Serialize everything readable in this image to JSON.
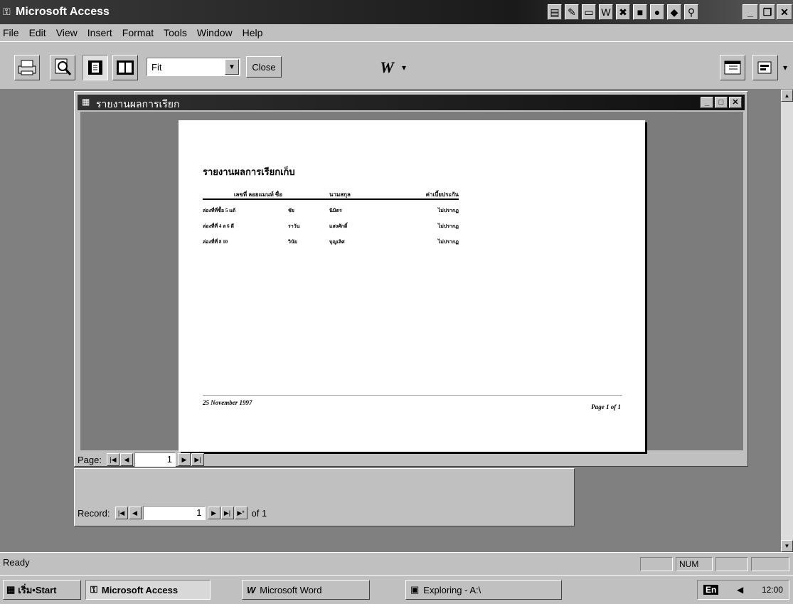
{
  "app": {
    "title": "Microsoft Access",
    "minimize": "_",
    "restore": "❐",
    "close": "✕"
  },
  "menu": [
    "File",
    "Edit",
    "View",
    "Insert",
    "Format",
    "Tools",
    "Window",
    "Help"
  ],
  "toolbar": {
    "zoom_value": "Fit",
    "close_label": "Close",
    "word_label": "W"
  },
  "report_window": {
    "title": "รายงานผลการเรียก"
  },
  "report": {
    "heading": "รายงานผลการเรียกเก็บ",
    "columns": [
      "เลขที่ ลอยแมนท์ ชื่อ",
      "",
      "นามสกุล",
      "ค่าเบี้ยประกัน"
    ],
    "rows": [
      [
        "ล่องที่ที่ซื้อ 5 แด้",
        "ชัย",
        "นิมิตร",
        "ไม่ปรากฏ"
      ],
      [
        "ล่องที่ที่ 4 ล 6 ดี",
        "ราวัน",
        "แสงศักดิ์",
        "ไม่ปรากฏ"
      ],
      [
        "ล่องที่ที่ 8 10",
        "วินัย",
        "บุญเลิศ",
        "ไม่ปรากฏ"
      ]
    ],
    "footer_date": "25 November 1997",
    "footer_page": "Page 1 of 1"
  },
  "page_nav": {
    "label": "Page:",
    "value": "1"
  },
  "record_nav": {
    "label": "Record:",
    "value": "1",
    "of_text": "of 1"
  },
  "status": {
    "text": "Ready",
    "num": "NUM"
  },
  "taskbar": {
    "start": "เริ่ม•Start",
    "tasks": [
      "Microsoft Access",
      "Microsoft Word",
      "Exploring - A:\\"
    ],
    "lang": "En",
    "clock": "12:00"
  }
}
